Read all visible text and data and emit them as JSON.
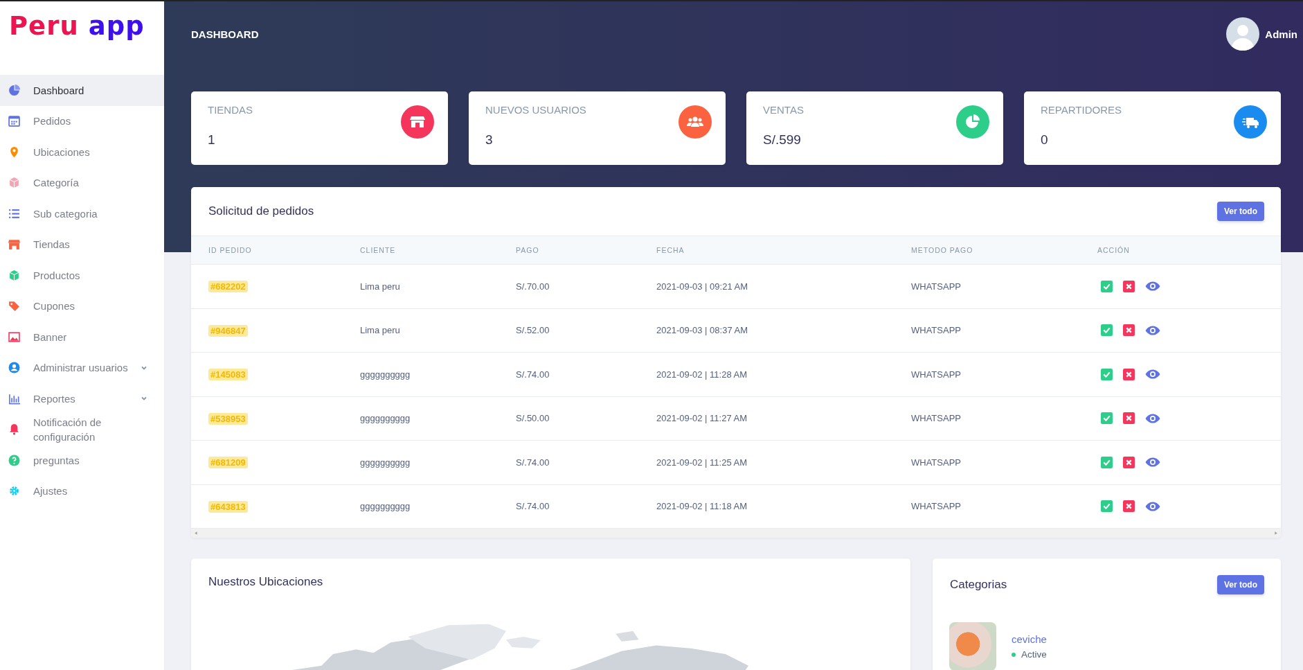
{
  "logo": {
    "words": [
      "Peru",
      "app"
    ]
  },
  "sidebar": {
    "items": [
      {
        "label": "Dashboard",
        "selected": true
      },
      {
        "label": "Pedidos",
        "selected": false
      },
      {
        "label": "Ubicaciones",
        "selected": false
      },
      {
        "label": "Categoría",
        "selected": false
      },
      {
        "label": "Sub categoria",
        "selected": false
      },
      {
        "label": "Tiendas",
        "selected": false
      },
      {
        "label": "Productos",
        "selected": false
      },
      {
        "label": "Cupones",
        "selected": false
      },
      {
        "label": "Banner",
        "selected": false
      },
      {
        "label": "Administrar usuarios",
        "selected": false,
        "expanded": false
      },
      {
        "label": "Reportes",
        "selected": false,
        "expanded": false
      },
      {
        "label": "Notificación de configuración",
        "selected": false
      },
      {
        "label": "preguntas",
        "selected": false
      },
      {
        "label": "Ajustes",
        "selected": false
      }
    ]
  },
  "header": {
    "title": "DASHBOARD",
    "user": "Admin"
  },
  "stats": [
    {
      "label": "TIENDAS",
      "value": "1",
      "color": "#f5365c"
    },
    {
      "label": "NUEVOS USUARIOS",
      "value": "3",
      "color": "#fb6340"
    },
    {
      "label": "VENTAS",
      "value": "S/.599",
      "color": "#2dce89"
    },
    {
      "label": "REPARTIDORES",
      "value": "0",
      "color": "#1a8cef"
    }
  ],
  "orders": {
    "title": "Solicitud de pedidos",
    "button": "Ver todo",
    "columns": [
      "ID PEDIDO",
      "CLIENTE",
      "PAGO",
      "FECHA",
      "METODO PAGO",
      "ACCIÓN"
    ],
    "rows": [
      {
        "id": "#682202",
        "client": "Lima peru",
        "amount": "S/.70.00",
        "date": "2021-09-03 | 09:21 AM",
        "method": "WHATSAPP"
      },
      {
        "id": "#946847",
        "client": "Lima peru",
        "amount": "S/.52.00",
        "date": "2021-09-03 | 08:37 AM",
        "method": "WHATSAPP"
      },
      {
        "id": "#145083",
        "client": "gggggggggg",
        "amount": "S/.74.00",
        "date": "2021-09-02 | 11:28 AM",
        "method": "WHATSAPP"
      },
      {
        "id": "#538953",
        "client": "gggggggggg",
        "amount": "S/.50.00",
        "date": "2021-09-02 | 11:27 AM",
        "method": "WHATSAPP"
      },
      {
        "id": "#681209",
        "client": "gggggggggg",
        "amount": "S/.74.00",
        "date": "2021-09-02 | 11:25 AM",
        "method": "WHATSAPP"
      },
      {
        "id": "#643813",
        "client": "gggggggggg",
        "amount": "S/.74.00",
        "date": "2021-09-02 | 11:18 AM",
        "method": "WHATSAPP"
      }
    ]
  },
  "locations": {
    "title": "Nuestros Ubicaciones"
  },
  "categories": {
    "title": "Categorias",
    "button": "Ver todo",
    "items": [
      {
        "name": "ceviche",
        "status": "Active"
      }
    ]
  }
}
